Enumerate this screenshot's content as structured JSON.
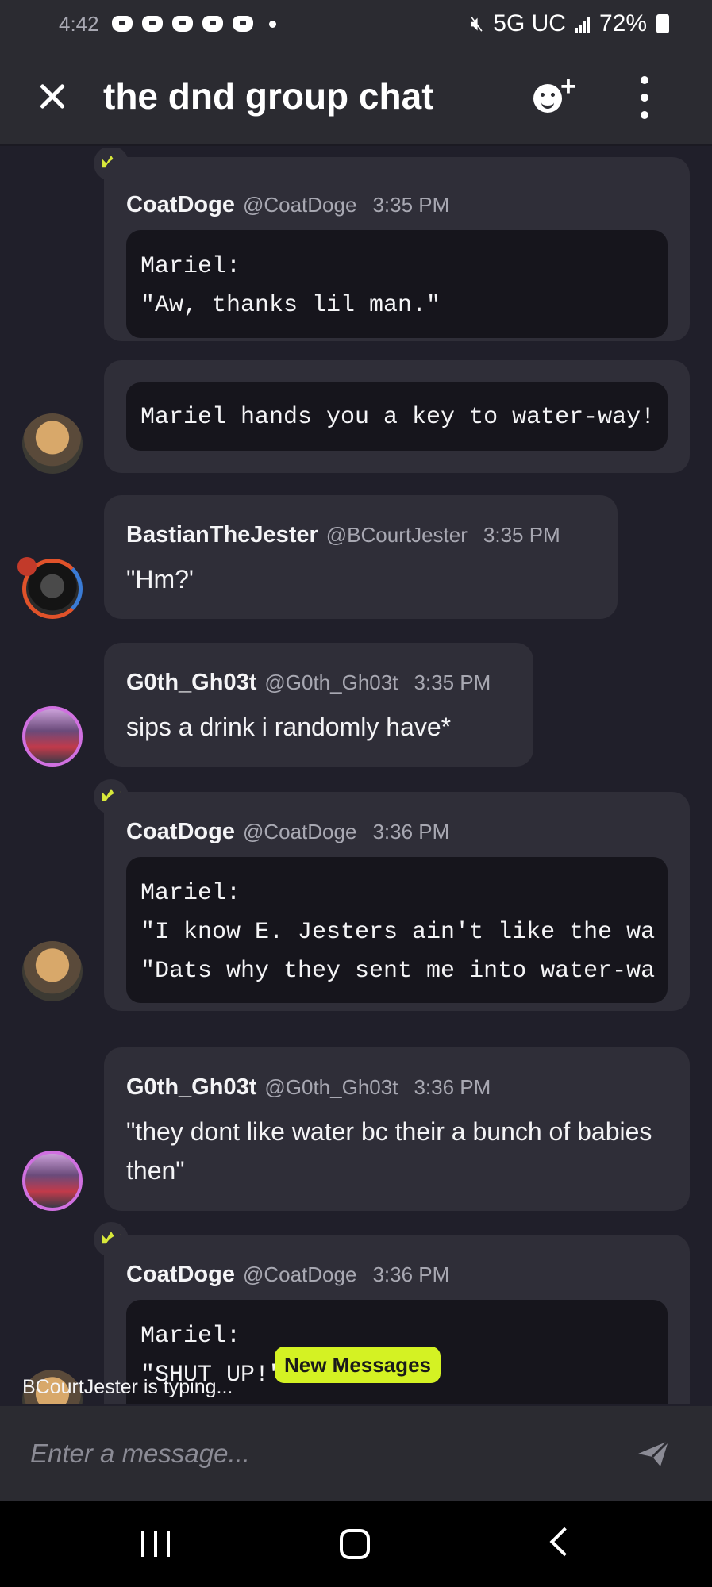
{
  "status_bar": {
    "time": "4:42",
    "network": "5G UC",
    "battery": "72%"
  },
  "header": {
    "title": "the dnd group chat",
    "close_icon": "close-icon",
    "add_member_icon": "add-member-icon",
    "more_icon": "more-options-icon"
  },
  "messages": [
    {
      "author": "CoatDoge",
      "handle": "@CoatDoge",
      "time": "3:35 PM",
      "code": "Mariel:\n\"Aw, thanks lil man.\""
    },
    {
      "code": "Mariel hands you a key to water-way!"
    },
    {
      "author": "BastianTheJester",
      "handle": "@BCourtJester",
      "time": "3:35 PM",
      "text": "\"Hm?'"
    },
    {
      "author": "G0th_Gh03t",
      "handle": "@G0th_Gh03t",
      "time": "3:35 PM",
      "text": "sips a drink i randomly have*"
    },
    {
      "author": "CoatDoge",
      "handle": "@CoatDoge",
      "time": "3:36 PM",
      "code": "Mariel:\n\"I know E. Jesters ain't like the wa\n\"Dats why they sent me into water-wa"
    },
    {
      "author": "G0th_Gh03t",
      "handle": "@G0th_Gh03t",
      "time": "3:36 PM",
      "text": "\"they dont like water bc their a bunch of babies then\""
    },
    {
      "author": "CoatDoge",
      "handle": "@CoatDoge",
      "time": "3:36 PM",
      "code": "Mariel:\n\"SHUT UP!\""
    }
  ],
  "typing_indicator": "BCourtJester is typing...",
  "new_messages_label": "New Messages",
  "composer": {
    "placeholder": "Enter a message...",
    "send_icon": "send-icon"
  },
  "colors": {
    "background": "#201f2a",
    "bubble": "#2f2e38",
    "code_block": "#16151c",
    "accent": "#d4f223"
  }
}
